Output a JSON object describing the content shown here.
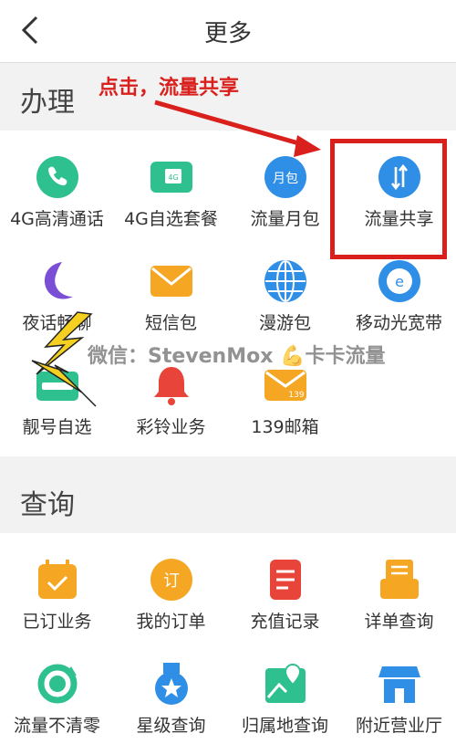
{
  "header": {
    "title": "更多"
  },
  "annotation": {
    "text": "点击，流量共享"
  },
  "watermark": {
    "text": "微信：StevenMox 💪卡卡流量"
  },
  "sections": [
    {
      "title": "办理",
      "items": [
        {
          "label": "4G高清通话",
          "icon": "phone-icon"
        },
        {
          "label": "4G自选套餐",
          "icon": "sim-card-icon",
          "badge": "4G"
        },
        {
          "label": "流量月包",
          "icon": "monthly-pack-icon",
          "badge": "月包"
        },
        {
          "label": "流量共享",
          "icon": "share-arrows-icon"
        },
        {
          "label": "夜话畅聊",
          "icon": "moon-icon"
        },
        {
          "label": "短信包",
          "icon": "envelope-icon"
        },
        {
          "label": "漫游包",
          "icon": "globe-icon"
        },
        {
          "label": "移动光宽带",
          "icon": "broadband-icon"
        },
        {
          "label": "靓号自选",
          "icon": "number-card-icon"
        },
        {
          "label": "彩铃业务",
          "icon": "bell-icon"
        },
        {
          "label": "139邮箱",
          "icon": "mailbox-139-icon",
          "badge": "139"
        }
      ]
    },
    {
      "title": "查询",
      "items": [
        {
          "label": "已订业务",
          "icon": "calendar-check-icon"
        },
        {
          "label": "我的订单",
          "icon": "order-icon",
          "badge": "订"
        },
        {
          "label": "充值记录",
          "icon": "recharge-record-icon"
        },
        {
          "label": "详单查询",
          "icon": "detail-bill-icon"
        },
        {
          "label": "流量不清零",
          "icon": "cycle-icon"
        },
        {
          "label": "星级查询",
          "icon": "star-medal-icon"
        },
        {
          "label": "归属地查询",
          "icon": "location-map-icon"
        },
        {
          "label": "附近营业厅",
          "icon": "store-icon"
        }
      ]
    }
  ],
  "colors": {
    "green": "#2fc08f",
    "blue": "#2f8fe6",
    "orange": "#f5a623",
    "purple": "#7a4fd6",
    "red": "#e8443a",
    "annotation": "#d9201c"
  }
}
